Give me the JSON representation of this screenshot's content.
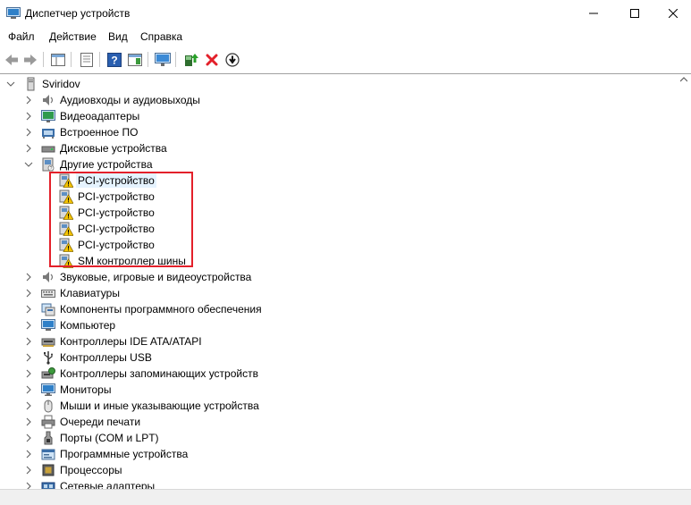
{
  "window": {
    "title": "Диспетчер устройств"
  },
  "menu": [
    "Файл",
    "Действие",
    "Вид",
    "Справка"
  ],
  "tree": {
    "root": "Sviridov",
    "categories": [
      {
        "id": "audio-io",
        "label": "Аудиовходы и аудиовыходы",
        "icon": "speaker-icon"
      },
      {
        "id": "video",
        "label": "Видеоадаптеры",
        "icon": "display-adapter-icon"
      },
      {
        "id": "firmware",
        "label": "Встроенное ПО",
        "icon": "firmware-icon"
      },
      {
        "id": "disks",
        "label": "Дисковые устройства",
        "icon": "disk-drive-icon"
      },
      {
        "id": "other",
        "label": "Другие устройства",
        "icon": "unknown-device-icon",
        "expanded": true,
        "children": [
          "PCI-устройство",
          "PCI-устройство",
          "PCI-устройство",
          "PCI-устройство",
          "PCI-устройство",
          "SM контроллер шины"
        ]
      },
      {
        "id": "sound",
        "label": "Звуковые, игровые и видеоустройства",
        "icon": "speaker-icon"
      },
      {
        "id": "keyboards",
        "label": "Клавиатуры",
        "icon": "keyboard-icon"
      },
      {
        "id": "software",
        "label": "Компоненты программного обеспечения",
        "icon": "software-component-icon"
      },
      {
        "id": "computer",
        "label": "Компьютер",
        "icon": "computer-icon"
      },
      {
        "id": "ide",
        "label": "Контроллеры IDE ATA/ATAPI",
        "icon": "ide-controller-icon"
      },
      {
        "id": "usb",
        "label": "Контроллеры USB",
        "icon": "usb-icon"
      },
      {
        "id": "storage",
        "label": "Контроллеры запоминающих устройств",
        "icon": "storage-controller-icon"
      },
      {
        "id": "monitors",
        "label": "Мониторы",
        "icon": "monitor-icon"
      },
      {
        "id": "mice",
        "label": "Мыши и иные указывающие устройства",
        "icon": "mouse-icon"
      },
      {
        "id": "print",
        "label": "Очереди печати",
        "icon": "printer-icon"
      },
      {
        "id": "ports",
        "label": "Порты (COM и LPT)",
        "icon": "port-icon"
      },
      {
        "id": "softdev",
        "label": "Программные устройства",
        "icon": "software-device-icon"
      },
      {
        "id": "cpu",
        "label": "Процессоры",
        "icon": "processor-icon"
      },
      {
        "id": "net",
        "label": "Сетевые адаптеры",
        "icon": "network-adapter-icon"
      }
    ]
  },
  "selected_child_index": 0,
  "highlight": {
    "color": "#e3202a"
  },
  "colors": {
    "selection": "#e5f3ff",
    "warning": "#f5c400",
    "error": "#e3202a"
  }
}
